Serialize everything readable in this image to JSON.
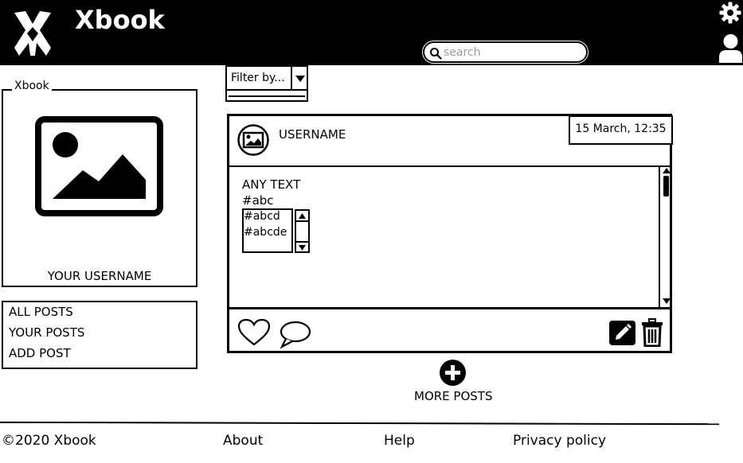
{
  "header": {
    "app_title": "Xbook",
    "logo_icon": "x-logo-icon",
    "search_placeholder": "search",
    "settings_icon": "gear-icon",
    "user_icon": "user-icon"
  },
  "profile": {
    "legend": "Xbook",
    "image_icon": "image-placeholder-icon",
    "username": "YOUR USERNAME"
  },
  "nav": {
    "items": [
      {
        "label": "ALL POSTS"
      },
      {
        "label": "YOUR POSTS"
      },
      {
        "label": "ADD POST"
      }
    ]
  },
  "filter": {
    "label": "Filter by..."
  },
  "post": {
    "username": "USERNAME",
    "date": "15 March, 12:35",
    "lines": [
      "ANY TEXT",
      "#abc"
    ],
    "hashtags": [
      "#abcd",
      "#abcde"
    ],
    "like_icon": "heart-icon",
    "comment_icon": "comment-icon",
    "edit_icon": "pencil-icon",
    "delete_icon": "trash-icon"
  },
  "more_posts": {
    "label": "MORE POSTS",
    "icon": "plus-circle-icon"
  },
  "footer": {
    "copyright": "©2020 Xbook",
    "about": "About",
    "help": "Help",
    "privacy": "Privacy policy"
  }
}
